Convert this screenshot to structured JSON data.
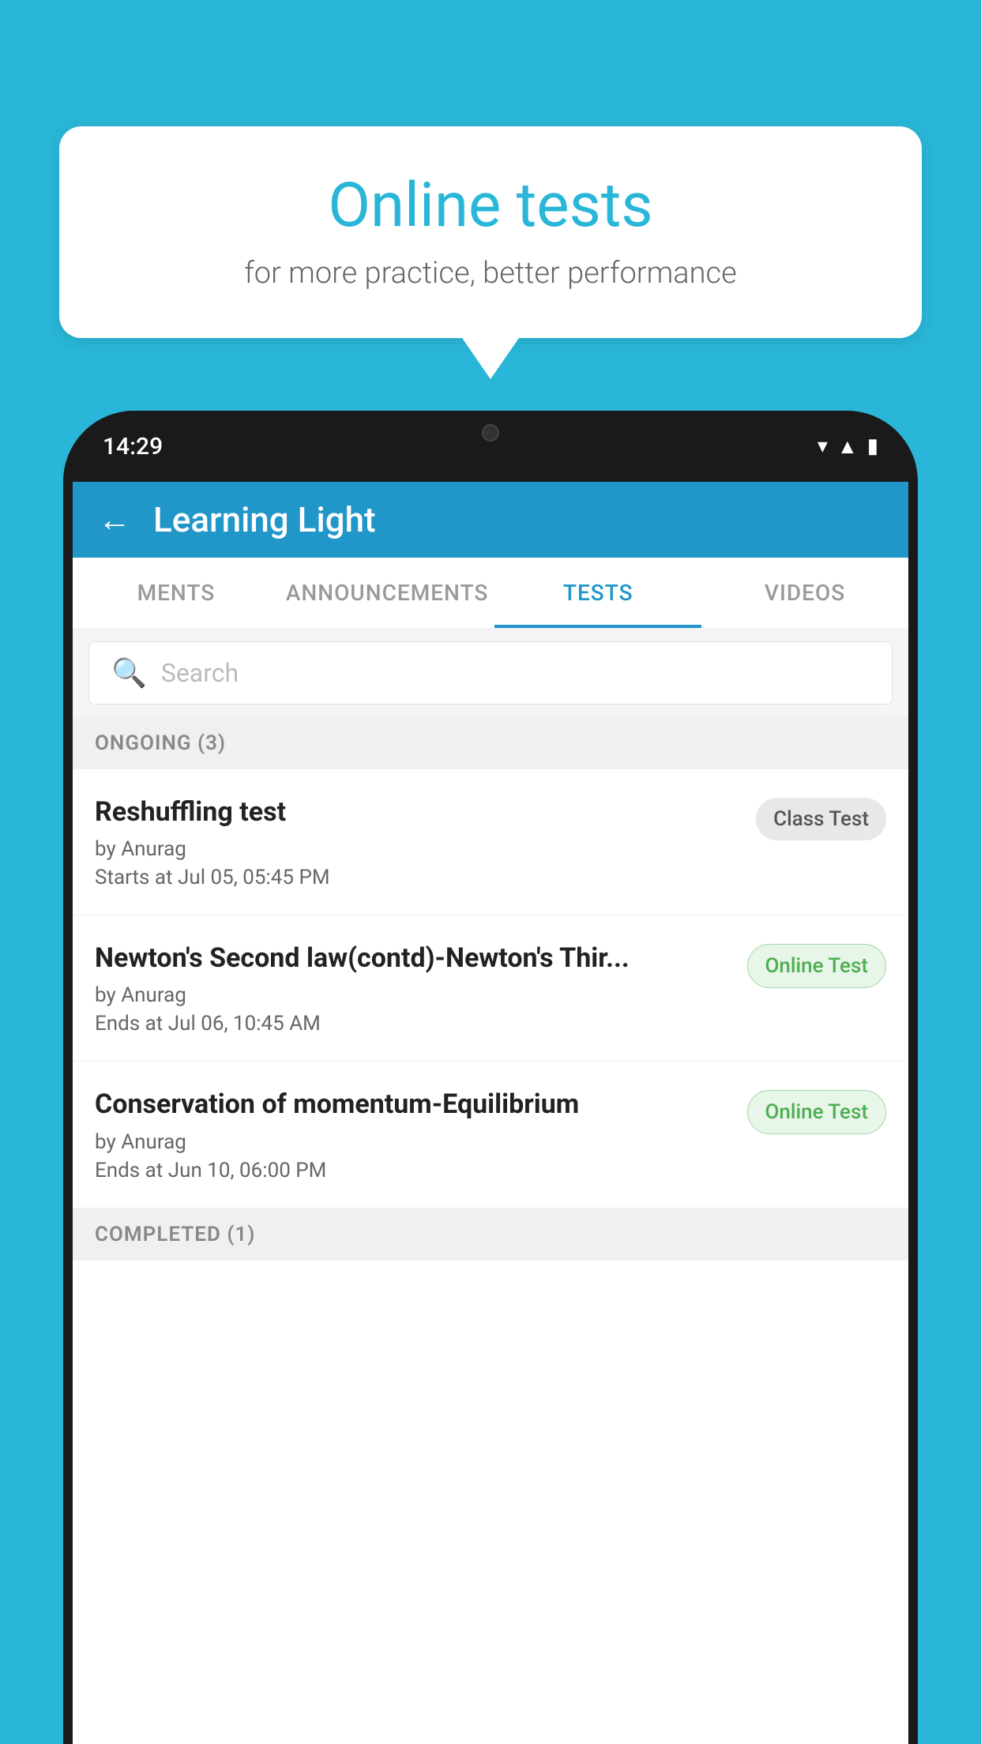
{
  "background_color": "#29b6d8",
  "bubble": {
    "title": "Online tests",
    "subtitle": "for more practice, better performance"
  },
  "phone": {
    "status_bar": {
      "time": "14:29"
    },
    "header": {
      "title": "Learning Light",
      "back_label": "←"
    },
    "tabs": [
      {
        "label": "MENTS",
        "active": false
      },
      {
        "label": "ANNOUNCEMENTS",
        "active": false
      },
      {
        "label": "TESTS",
        "active": true
      },
      {
        "label": "VIDEOS",
        "active": false
      }
    ],
    "search": {
      "placeholder": "Search"
    },
    "ongoing_section": {
      "label": "ONGOING (3)"
    },
    "tests": [
      {
        "name": "Reshuffling test",
        "author": "by Anurag",
        "time_label": "Starts at",
        "time": "Jul 05, 05:45 PM",
        "badge": "Class Test",
        "badge_type": "class"
      },
      {
        "name": "Newton's Second law(contd)-Newton's Thir...",
        "author": "by Anurag",
        "time_label": "Ends at",
        "time": "Jul 06, 10:45 AM",
        "badge": "Online Test",
        "badge_type": "online"
      },
      {
        "name": "Conservation of momentum-Equilibrium",
        "author": "by Anurag",
        "time_label": "Ends at",
        "time": "Jun 10, 06:00 PM",
        "badge": "Online Test",
        "badge_type": "online"
      }
    ],
    "completed_section": {
      "label": "COMPLETED (1)"
    }
  }
}
